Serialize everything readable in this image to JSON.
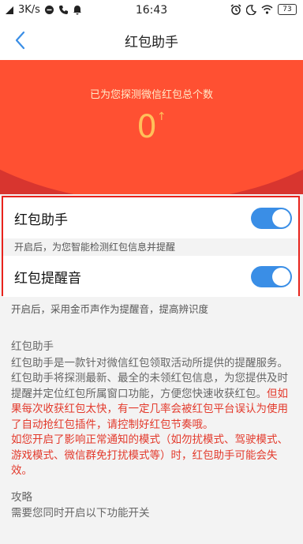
{
  "status_bar": {
    "network_speed": "3K/s",
    "time": "16:43",
    "battery": "73"
  },
  "header": {
    "title": "红包助手"
  },
  "hero": {
    "caption": "已为您探测微信红包总个数",
    "count": "0",
    "trend_arrow": "↑"
  },
  "settings": [
    {
      "label": "红包助手",
      "enabled": true,
      "hint": "开启后，为您智能检测红包信息并提醒"
    },
    {
      "label": "红包提醒音",
      "enabled": true,
      "hint": "开启后，采用金币声作为提醒音，提高辨识度"
    }
  ],
  "description": {
    "title": "红包助手",
    "body": "红包助手是一款针对微信红包领取活动所提供的提醒服务。红包助手将探测最新、最全的未领红包信息，为您提供及时提醒并定位红包所属窗口功能，方便您快速收获红包。",
    "warning1": "但如果每次收获红包太快，有一定几率会被红包平台误认为使用了自动抢红包插件，请控制好红包节奏哦。",
    "warning2": "如您开启了影响正常通知的模式（如勿扰模式、驾驶模式、游戏模式、微信群免打扰模式等）时，红包助手可能会失效。"
  },
  "strategy": {
    "title": "攻略",
    "text": "需要您同时开启以下功能开关"
  },
  "colors": {
    "accent": "#3a8ee6",
    "hero_red": "#ff5032",
    "highlight_border": "#e8231c",
    "warning_text": "#e33a2c"
  }
}
